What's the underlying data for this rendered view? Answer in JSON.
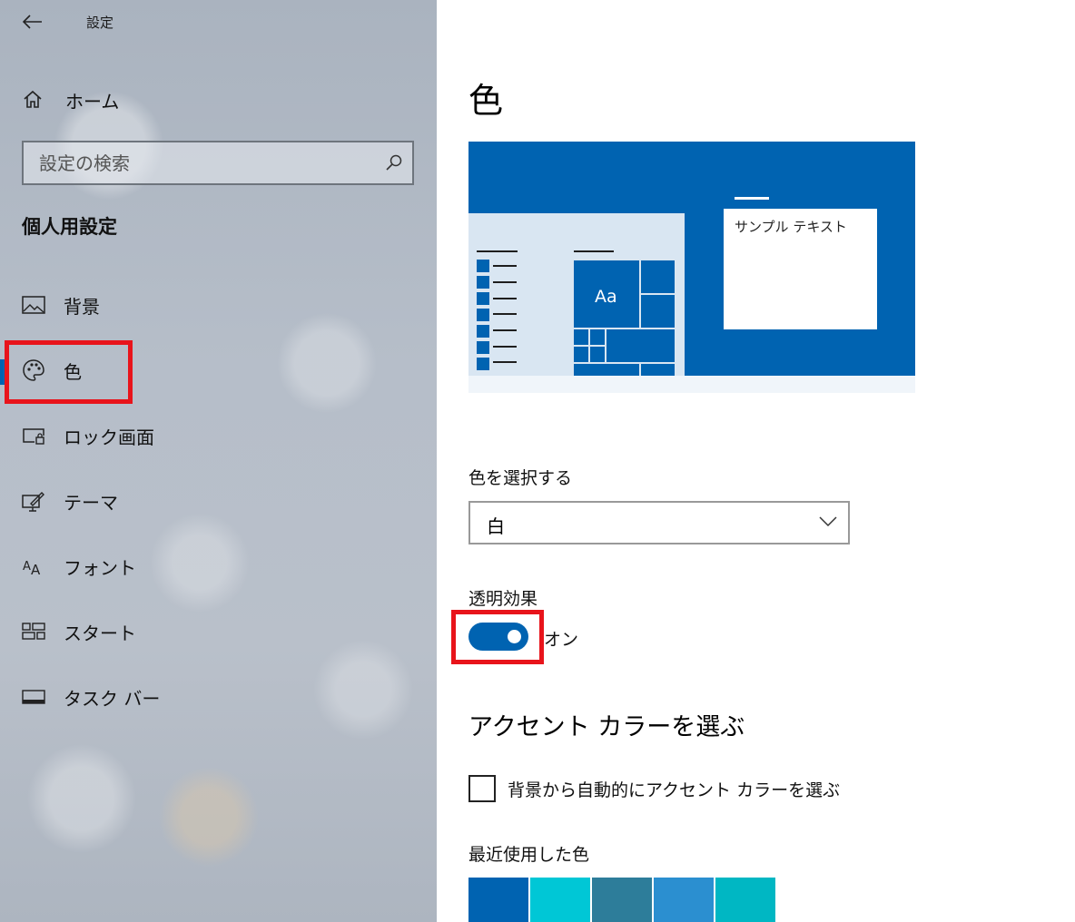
{
  "window": {
    "title": "設定"
  },
  "sidebar": {
    "home_label": "ホーム",
    "search_placeholder": "設定の検索",
    "section_title": "個人用設定",
    "items": [
      {
        "label": "背景",
        "icon": "picture-icon"
      },
      {
        "label": "色",
        "icon": "palette-icon",
        "active": true
      },
      {
        "label": "ロック画面",
        "icon": "lock-screen-icon"
      },
      {
        "label": "テーマ",
        "icon": "theme-brush-icon"
      },
      {
        "label": "フォント",
        "icon": "font-icon"
      },
      {
        "label": "スタート",
        "icon": "start-tiles-icon"
      },
      {
        "label": "タスク バー",
        "icon": "taskbar-icon"
      }
    ]
  },
  "main": {
    "page_title": "色",
    "preview": {
      "sample_text": "サンプル テキスト",
      "tile_text": "Aa"
    },
    "choose_color": {
      "label": "色を選択する",
      "value": "白"
    },
    "transparency": {
      "label": "透明効果",
      "state": "オン",
      "on": true
    },
    "accent": {
      "heading": "アクセント カラーを選ぶ",
      "auto_checkbox_label": "背景から自動的にアクセント カラーを選ぶ",
      "auto_checked": false,
      "recent_label": "最近使用した色",
      "recent_colors": [
        "#0063b1",
        "#00c7d6",
        "#2d7d9a",
        "#2b8fd0",
        "#00b7c3"
      ]
    }
  },
  "colors": {
    "accent": "#0063b1",
    "highlight": "#e8141b"
  }
}
